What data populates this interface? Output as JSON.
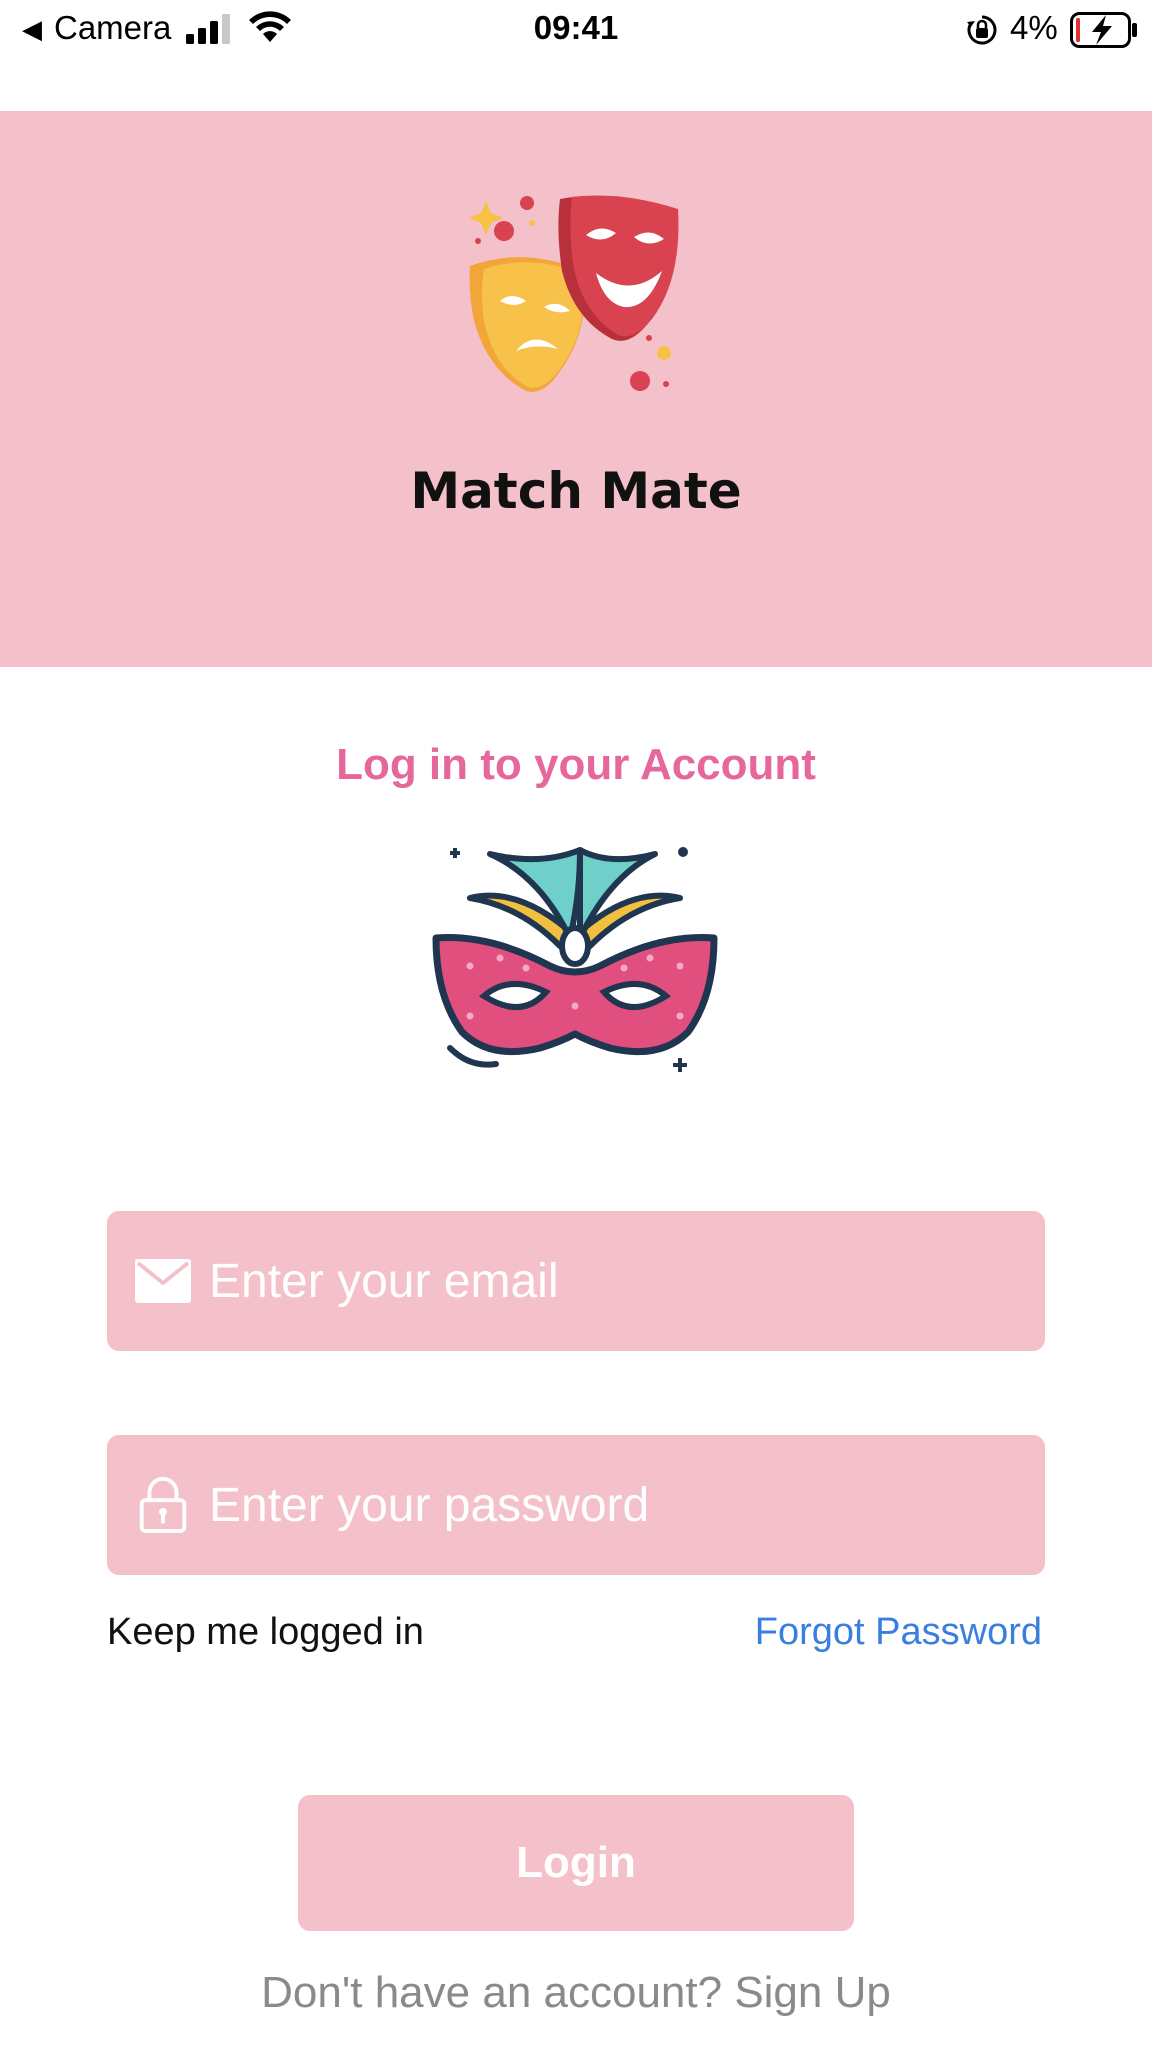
{
  "status_bar": {
    "back_glyph": "◀",
    "carrier": "Camera",
    "time": "09:41",
    "battery_percent": "4%",
    "icons": [
      "signal-icon",
      "wifi-icon",
      "orientation-lock-icon",
      "battery-charging-icon"
    ]
  },
  "header": {
    "app_name": "Match Mate",
    "logo_icon": "theater-masks-icon",
    "background": "#f4c1cb"
  },
  "login": {
    "heading": "Log in to your Account",
    "illustration_icon": "carnival-mask-icon",
    "email": {
      "value": "",
      "placeholder": "Enter your email",
      "icon": "mail-icon"
    },
    "password": {
      "value": "",
      "placeholder": "Enter your password",
      "icon": "lock-icon"
    },
    "keep_logged_in": "Keep me logged in",
    "forgot_password": "Forgot Password",
    "login_button": "Login",
    "signup_prompt": "Don't have an account? Sign Up"
  },
  "colors": {
    "accent_pink": "#e5679c",
    "field_pink": "#f4c1cb",
    "link_blue": "#3a7ee0",
    "muted_gray": "#8a8a8a"
  }
}
